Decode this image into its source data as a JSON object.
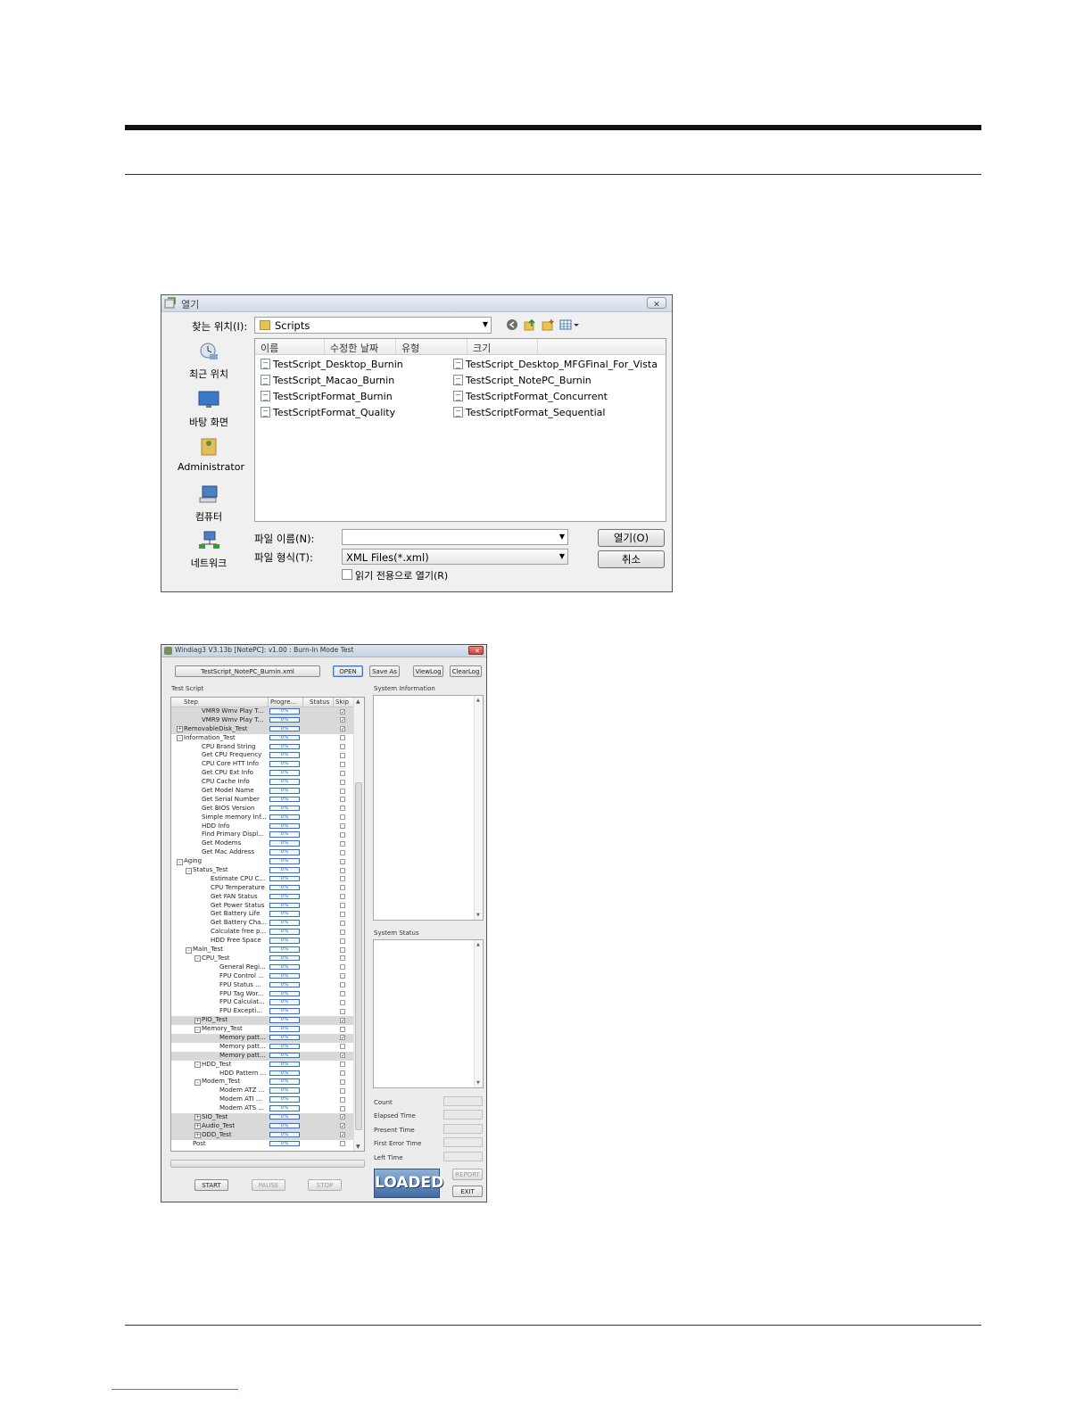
{
  "open_dialog": {
    "title": "열기",
    "close_label": "✕",
    "look_in_label": "찾는 위치(I):",
    "look_in_value": "Scripts",
    "places": [
      "최근 위치",
      "바탕 화면",
      "Administrator",
      "컴퓨터",
      "네트워크"
    ],
    "columns": [
      "이름",
      "수정한 날짜",
      "유형",
      "크기"
    ],
    "files_col1": [
      "TestScript_Desktop_Burnin",
      "TestScript_Macao_Burnin",
      "TestScriptFormat_Burnin",
      "TestScriptFormat_Quality"
    ],
    "files_col2": [
      "TestScript_Desktop_MFGFinal_For_Vista",
      "TestScript_NotePC_Burnin",
      "TestScriptFormat_Concurrent",
      "TestScriptFormat_Sequential"
    ],
    "filename_label": "파일 이름(N):",
    "filename_value": "",
    "filetype_label": "파일 형식(T):",
    "filetype_value": "XML Files(*.xml)",
    "readonly_label": "읽기 전용으로 열기(R)",
    "open_button": "열기(O)",
    "cancel_button": "취소"
  },
  "windiag": {
    "title": "Windiag3  V3.13b  [NotePC]: v1.00 : Burn-In Mode Test",
    "close_label": "✕",
    "script_button": "TestScript_NotePC_Burnin.xml",
    "open_button": "OPEN",
    "saveas_button": "Save As",
    "viewlog_button": "ViewLog",
    "clearlog_button": "ClearLog",
    "test_script_label": "Test Script",
    "system_info_label": "System Information",
    "system_status_label": "System Status",
    "tree_columns": [
      "Step",
      "Progre...",
      "Status",
      "Skip"
    ],
    "progress_text": "0%",
    "rows": [
      {
        "name": "VMR9 Wmv Play T...",
        "level": 3,
        "exp": "",
        "skip": true,
        "hl": true
      },
      {
        "name": "VMR9 Wmv Play T...",
        "level": 3,
        "exp": "",
        "skip": true,
        "hl": true
      },
      {
        "name": "RemovableDisk_Test",
        "level": 1,
        "exp": "+",
        "skip": true,
        "hl": true
      },
      {
        "name": "Information_Test",
        "level": 1,
        "exp": "-",
        "skip": false,
        "hl": false
      },
      {
        "name": "CPU Brand String",
        "level": 3,
        "exp": "",
        "skip": false,
        "hl": false
      },
      {
        "name": "Get CPU Frequency",
        "level": 3,
        "exp": "",
        "skip": false,
        "hl": false
      },
      {
        "name": "CPU Core HTT Info",
        "level": 3,
        "exp": "",
        "skip": false,
        "hl": false
      },
      {
        "name": "Get CPU Ext Info",
        "level": 3,
        "exp": "",
        "skip": false,
        "hl": false
      },
      {
        "name": "CPU Cache Info",
        "level": 3,
        "exp": "",
        "skip": false,
        "hl": false
      },
      {
        "name": "Get Model Name",
        "level": 3,
        "exp": "",
        "skip": false,
        "hl": false
      },
      {
        "name": "Get Serial Number",
        "level": 3,
        "exp": "",
        "skip": false,
        "hl": false
      },
      {
        "name": "Get BIOS Version",
        "level": 3,
        "exp": "",
        "skip": false,
        "hl": false
      },
      {
        "name": "Simple memory Inf...",
        "level": 3,
        "exp": "",
        "skip": false,
        "hl": false
      },
      {
        "name": "HDD Info",
        "level": 3,
        "exp": "",
        "skip": false,
        "hl": false
      },
      {
        "name": "Find Primary Displ...",
        "level": 3,
        "exp": "",
        "skip": false,
        "hl": false
      },
      {
        "name": "Get Modems",
        "level": 3,
        "exp": "",
        "skip": false,
        "hl": false
      },
      {
        "name": "Get Mac Address",
        "level": 3,
        "exp": "",
        "skip": false,
        "hl": false
      },
      {
        "name": "Aging",
        "level": 1,
        "exp": "-",
        "skip": false,
        "hl": false
      },
      {
        "name": "Status_Test",
        "level": 2,
        "exp": "-",
        "skip": false,
        "hl": false
      },
      {
        "name": "Estimate CPU C...",
        "level": 4,
        "exp": "",
        "skip": false,
        "hl": false
      },
      {
        "name": "CPU Temperature",
        "level": 4,
        "exp": "",
        "skip": false,
        "hl": false
      },
      {
        "name": "Get FAN Status",
        "level": 4,
        "exp": "",
        "skip": false,
        "hl": false
      },
      {
        "name": "Get Power Status",
        "level": 4,
        "exp": "",
        "skip": false,
        "hl": false
      },
      {
        "name": "Get Battery Life",
        "level": 4,
        "exp": "",
        "skip": false,
        "hl": false
      },
      {
        "name": "Get Battery Cha...",
        "level": 4,
        "exp": "",
        "skip": false,
        "hl": false
      },
      {
        "name": "Calculate free p...",
        "level": 4,
        "exp": "",
        "skip": false,
        "hl": false
      },
      {
        "name": "HDD Free Space",
        "level": 4,
        "exp": "",
        "skip": false,
        "hl": false
      },
      {
        "name": "Main_Test",
        "level": 2,
        "exp": "-",
        "skip": false,
        "hl": false
      },
      {
        "name": "CPU_Test",
        "level": 3,
        "exp": "-",
        "skip": false,
        "hl": false
      },
      {
        "name": "General Regi...",
        "level": 5,
        "exp": "",
        "skip": false,
        "hl": false
      },
      {
        "name": "FPU Control ...",
        "level": 5,
        "exp": "",
        "skip": false,
        "hl": false
      },
      {
        "name": "FPU Status ...",
        "level": 5,
        "exp": "",
        "skip": false,
        "hl": false
      },
      {
        "name": "FPU Tag Wor...",
        "level": 5,
        "exp": "",
        "skip": false,
        "hl": false
      },
      {
        "name": "FPU Calculat...",
        "level": 5,
        "exp": "",
        "skip": false,
        "hl": false
      },
      {
        "name": "FPU Excepti...",
        "level": 5,
        "exp": "",
        "skip": false,
        "hl": false
      },
      {
        "name": "PIO_Test",
        "level": 3,
        "exp": "+",
        "skip": true,
        "hl": true
      },
      {
        "name": "Memory_Test",
        "level": 3,
        "exp": "-",
        "skip": false,
        "hl": false
      },
      {
        "name": "Memory patt...",
        "level": 5,
        "exp": "",
        "skip": true,
        "hl": true
      },
      {
        "name": "Memory patt...",
        "level": 5,
        "exp": "",
        "skip": false,
        "hl": false
      },
      {
        "name": "Memory patt...",
        "level": 5,
        "exp": "",
        "skip": true,
        "hl": true
      },
      {
        "name": "HDD_Test",
        "level": 3,
        "exp": "-",
        "skip": false,
        "hl": false
      },
      {
        "name": "HDD Pattern ...",
        "level": 5,
        "exp": "",
        "skip": false,
        "hl": false
      },
      {
        "name": "Modem_Test",
        "level": 3,
        "exp": "-",
        "skip": false,
        "hl": false
      },
      {
        "name": "Modem ATZ ...",
        "level": 5,
        "exp": "",
        "skip": false,
        "hl": false
      },
      {
        "name": "Modem ATI ...",
        "level": 5,
        "exp": "",
        "skip": false,
        "hl": false
      },
      {
        "name": "Modem ATS ...",
        "level": 5,
        "exp": "",
        "skip": false,
        "hl": false
      },
      {
        "name": "SIO_Test",
        "level": 3,
        "exp": "+",
        "skip": true,
        "hl": true
      },
      {
        "name": "Audio_Test",
        "level": 3,
        "exp": "+",
        "skip": true,
        "hl": true
      },
      {
        "name": "ODD_Test",
        "level": 3,
        "exp": "+",
        "skip": true,
        "hl": true
      },
      {
        "name": "Post",
        "level": 2,
        "exp": "",
        "skip": false,
        "hl": false
      }
    ],
    "count_label": "Count",
    "elapsed_label": "Elapsed Time",
    "present_label": "Present Time",
    "first_error_label": "First Error Time",
    "left_label": "Left Time",
    "start_button": "START",
    "pause_button": "PAUSE",
    "stop_button": "STOP",
    "loaded_badge": "LOADED",
    "report_button": "REPORT",
    "exit_button": "EXIT"
  }
}
